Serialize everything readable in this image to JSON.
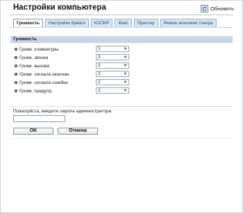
{
  "header": {
    "title": "Настройки компьютера",
    "refresh_label": "Обновить",
    "refresh_icon": "refresh-icon"
  },
  "tabs": [
    {
      "label": "Громкость",
      "active": true
    },
    {
      "label": "Настройки бумаги",
      "active": false
    },
    {
      "label": "КОПИР",
      "active": false
    },
    {
      "label": "Факс",
      "active": false
    },
    {
      "label": "Принтер",
      "active": false
    },
    {
      "label": "Режим экономии тонера",
      "active": false
    }
  ],
  "section": {
    "title": "Громкость",
    "rows": [
      {
        "label": "Громк. клавиатуры",
        "value": "1"
      },
      {
        "label": "Громк. звонка",
        "value": "2"
      },
      {
        "label": "Громк. вызова",
        "value": "2"
      },
      {
        "label": "Громк. сигнала окончан.",
        "value": "2"
      },
      {
        "label": "Громк. сигнала ошибки",
        "value": "2"
      },
      {
        "label": "Громк. предупр.",
        "value": "2"
      }
    ]
  },
  "password": {
    "label": "Пожалуйста, введите пароль администратора",
    "value": "",
    "placeholder": ""
  },
  "buttons": {
    "ok": "OK",
    "cancel": "Отмена"
  },
  "colors": {
    "section_header_bg": "#c8d6e6",
    "tab_bg": "#d7e4f1",
    "active_tab_bg": "#ffffff"
  }
}
